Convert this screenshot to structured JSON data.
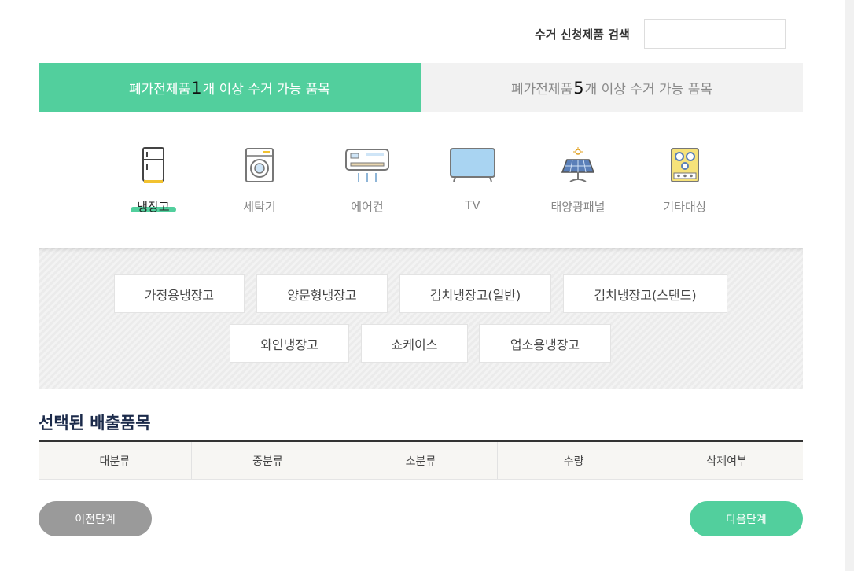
{
  "search": {
    "label": "수거 신청제품 검색",
    "value": "",
    "placeholder": ""
  },
  "tabs": [
    {
      "prefix": "폐가전제품 ",
      "num": "1",
      "suffix": "개 이상 수거 가능 품목",
      "active": true
    },
    {
      "prefix": "폐가전제품 ",
      "num": "5",
      "suffix": "개 이상 수거 가능 품목",
      "active": false
    }
  ],
  "categories": [
    {
      "label": "냉장고",
      "icon": "refrigerator-icon",
      "active": true
    },
    {
      "label": "세탁기",
      "icon": "washing-machine-icon",
      "active": false
    },
    {
      "label": "에어컨",
      "icon": "air-conditioner-icon",
      "active": false
    },
    {
      "label": "TV",
      "icon": "tv-icon",
      "active": false
    },
    {
      "label": "태양광패널",
      "icon": "solar-panel-icon",
      "active": false
    },
    {
      "label": "기타대상",
      "icon": "stove-icon",
      "active": false
    }
  ],
  "subcategories": [
    "가정용냉장고",
    "양문형냉장고",
    "김치냉장고(일반)",
    "김치냉장고(스탠드)",
    "와인냉장고",
    "쇼케이스",
    "업소용냉장고"
  ],
  "selected": {
    "title": "선택된 배출품목",
    "columns": [
      "대분류",
      "중분류",
      "소분류",
      "수량",
      "삭제여부"
    ]
  },
  "buttons": {
    "prev": "이전단계",
    "next": "다음단계"
  },
  "colors": {
    "accent": "#52cf9d",
    "inactive_tab": "#f2f2f2",
    "prev_button": "#9a9a9a",
    "title": "#1b2a4a"
  }
}
